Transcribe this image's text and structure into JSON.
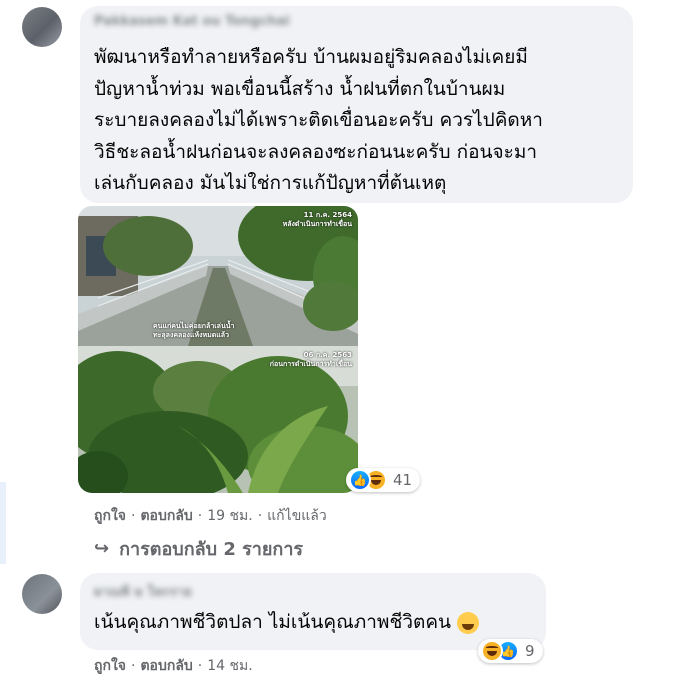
{
  "comments": [
    {
      "author": "Pakkasem Kat ou Tongchai",
      "text_lines": [
        "พัฒนาหรือทำลายหรือครับ บ้านผมอยู่ริมคลองไม่เคยมี",
        "ปัญหาน้ำท่วม พอเขื่อนนี้สร้าง น้ำฝนที่ตกในบ้านผม",
        "ระบายลงคลองไม่ได้เพราะติดเขื่อนอะครับ ควรไปคิดหา",
        "วิธีชะลอน้ำฝนก่อนจะลงคลองซะก่อนนะครับ ก่อนจะมา",
        "เล่นกับคลอง มันไม่ใช่การแก้ปัญหาที่ต้นเหตุ"
      ],
      "photo_top": {
        "stamp": "11 ก.ค. 2564",
        "stamp2": "หลังดำเนินการทำเขื่อน",
        "caption1": "คนแก่คนไม่ค่อยกล้าเล่นน้ำ",
        "caption2": "ทะลุลงคลองแห้งหมดแล้ว"
      },
      "photo_bottom": {
        "stamp": "06 ก.ค. 2563",
        "stamp2": "ก่อนการดำเนินการทำเขื่อน"
      },
      "reactions": {
        "icons": [
          "like-icon",
          "haha-icon"
        ],
        "count": "41"
      },
      "actions": {
        "like": "ถูกใจ",
        "reply": "ตอบกลับ",
        "time": "19 ชม.",
        "edited": "แก้ไขแล้ว"
      }
    },
    {
      "author": "ผาณพี ษ ใหกราย",
      "text": "เน้นคุณภาพชีวิตปลา ไม่เน้นคุณภาพชีวิตคน",
      "reactions": {
        "icons": [
          "haha-icon",
          "like-icon"
        ],
        "count": "9"
      },
      "actions": {
        "like": "ถูกใจ",
        "reply": "ตอบกลับ",
        "time": "14 ชม."
      }
    }
  ],
  "replies_link": {
    "arrow": "↪",
    "label": "การตอบกลับ 2 รายการ"
  },
  "separator": "·",
  "colors": {
    "bubble": "#f0f2f5",
    "meta": "#65676b",
    "like_blue": "#0866ff",
    "haha_yellow": "#f7b125"
  }
}
